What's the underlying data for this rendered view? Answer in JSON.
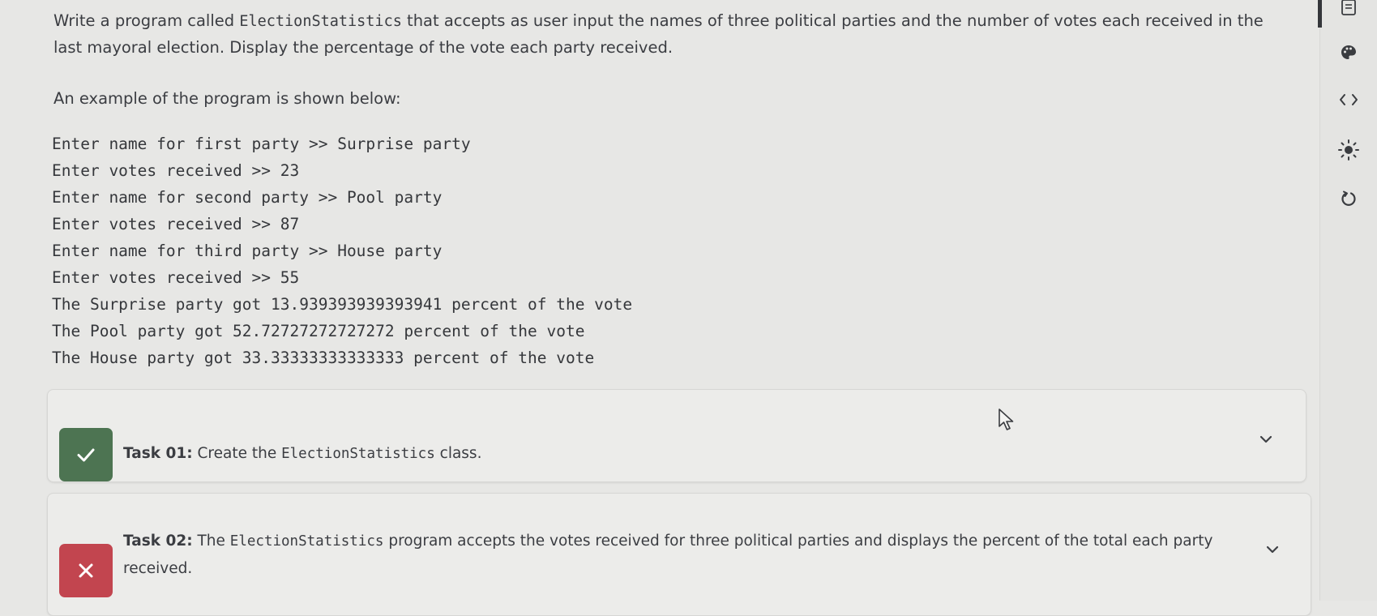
{
  "instructions": {
    "part1": "Write a program called ",
    "class_name": "ElectionStatistics",
    "part2": " that accepts as user input the names of three political parties and the number of votes each received in the last mayoral election. Display the percentage of the vote each party received.",
    "example_heading": "An example of the program is shown below:"
  },
  "console_lines": [
    "Enter name for first party >> Surprise party",
    "Enter votes received >> 23",
    "Enter name for second party >> Pool party",
    "Enter votes received >> 87",
    "Enter name for third party >> House party",
    "Enter votes received >> 55",
    "The Surprise party got 13.939393939393941 percent of the vote",
    "The Pool party got 52.72727272727272 percent of the vote",
    "The House party got 33.33333333333333 percent of the vote"
  ],
  "tasks": [
    {
      "number_label": "Task 01:",
      "text_before": " Create the ",
      "code": "ElectionStatistics",
      "text_after": " class.",
      "status": "passed",
      "status_icon": "checkmark-icon",
      "status_color": "#4d7452"
    },
    {
      "number_label": "Task 02:",
      "text_before": " The ",
      "code": "ElectionStatistics",
      "text_after": " program accepts the votes received for three political parties and displays the percent of the total each party received.",
      "status": "failed",
      "status_icon": "x-icon",
      "status_color": "#c2454f"
    }
  ],
  "right_rail": {
    "icons": [
      "document-icon",
      "palette-icon",
      "code-icon",
      "brightness-icon",
      "reset-icon"
    ]
  },
  "colors": {
    "background": "#e7e7e5",
    "card": "#ececea",
    "pass": "#4d7452",
    "fail": "#c2454f"
  }
}
